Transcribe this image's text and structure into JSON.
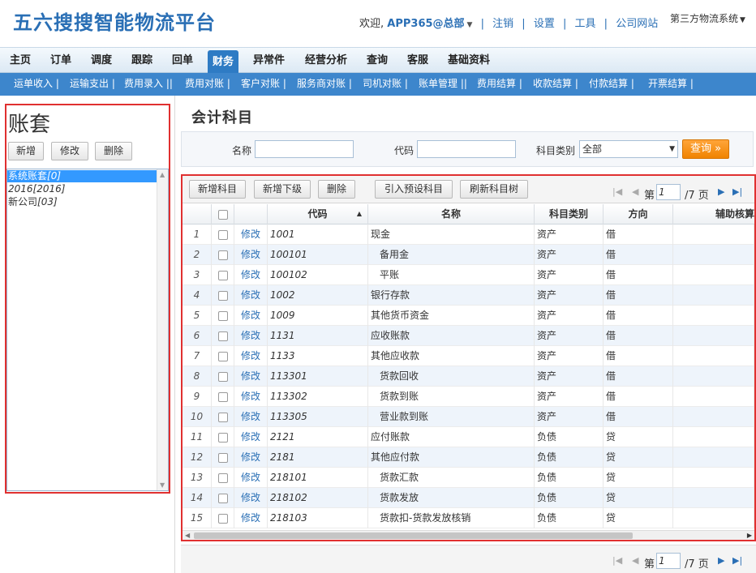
{
  "header": {
    "logo": "五六搜搜智能物流平台",
    "welcome": "欢迎,",
    "username": "APP365@总部",
    "links": [
      "注销",
      "设置",
      "工具",
      "公司网站"
    ],
    "system_switch": "第三方物流系统"
  },
  "main_nav": {
    "items": [
      "主页",
      "订单",
      "调度",
      "跟踪",
      "回单",
      "财务",
      "异常件",
      "经营分析",
      "查询",
      "客服",
      "基础资料"
    ],
    "active": "财务"
  },
  "sub_nav": {
    "items": [
      "运单收入 |",
      "运输支出 |",
      "费用录入 ||",
      "费用对账 |",
      "客户对账 |",
      "服务商对账 |",
      "司机对账 |",
      "账单管理 ||",
      "费用结算 |",
      "收款结算 |",
      "付款结算 |",
      "开票结算 |"
    ]
  },
  "left_panel": {
    "title": "账套",
    "buttons": {
      "add": "新增",
      "edit": "修改",
      "delete": "删除"
    },
    "accounts": [
      {
        "name": "系统账套",
        "code": "[0]",
        "selected": true
      },
      {
        "name": "2016",
        "code": "[2016]",
        "selected": false
      },
      {
        "name": "新公司",
        "code": "[03]",
        "selected": false
      }
    ]
  },
  "page_title": "会计科目",
  "search": {
    "name_label": "名称",
    "name_value": "",
    "code_label": "代码",
    "code_value": "",
    "category_label": "科目类别",
    "category_value": "全部",
    "query_button": "查询 »"
  },
  "toolbar": {
    "add_subject": "新增科目",
    "add_child": "新增下级",
    "delete": "删除",
    "import_preset": "引入预设科目",
    "refresh_tree": "刷新科目树"
  },
  "pager": {
    "prefix": "第",
    "current_page": "1",
    "suffix": "/7 页"
  },
  "grid": {
    "columns": {
      "code": "代码",
      "name": "名称",
      "category": "科目类别",
      "direction": "方向",
      "auxiliary": "辅助核算"
    },
    "edit_label": "修改",
    "rows": [
      {
        "num": "1",
        "code": "1001",
        "name": "现金",
        "category": "资产",
        "direction": "借",
        "indent": false
      },
      {
        "num": "2",
        "code": "100101",
        "name": "备用金",
        "category": "资产",
        "direction": "借",
        "indent": true
      },
      {
        "num": "3",
        "code": "100102",
        "name": "平账",
        "category": "资产",
        "direction": "借",
        "indent": true
      },
      {
        "num": "4",
        "code": "1002",
        "name": "银行存款",
        "category": "资产",
        "direction": "借",
        "indent": false
      },
      {
        "num": "5",
        "code": "1009",
        "name": "其他货币资金",
        "category": "资产",
        "direction": "借",
        "indent": false
      },
      {
        "num": "6",
        "code": "1131",
        "name": "应收账款",
        "category": "资产",
        "direction": "借",
        "indent": false
      },
      {
        "num": "7",
        "code": "1133",
        "name": "其他应收款",
        "category": "资产",
        "direction": "借",
        "indent": false
      },
      {
        "num": "8",
        "code": "113301",
        "name": "货款回收",
        "category": "资产",
        "direction": "借",
        "indent": true
      },
      {
        "num": "9",
        "code": "113302",
        "name": "货款到账",
        "category": "资产",
        "direction": "借",
        "indent": true
      },
      {
        "num": "10",
        "code": "113305",
        "name": "营业款到账",
        "category": "资产",
        "direction": "借",
        "indent": true
      },
      {
        "num": "11",
        "code": "2121",
        "name": "应付账款",
        "category": "负债",
        "direction": "贷",
        "indent": false
      },
      {
        "num": "12",
        "code": "2181",
        "name": "其他应付款",
        "category": "负债",
        "direction": "贷",
        "indent": false
      },
      {
        "num": "13",
        "code": "218101",
        "name": "货款汇款",
        "category": "负债",
        "direction": "贷",
        "indent": true
      },
      {
        "num": "14",
        "code": "218102",
        "name": "货款发放",
        "category": "负债",
        "direction": "贷",
        "indent": true
      },
      {
        "num": "15",
        "code": "218103",
        "name": "货款扣-货款发放核销",
        "category": "负债",
        "direction": "贷",
        "indent": true
      }
    ]
  },
  "colors": {
    "accent": "#2e7bc4",
    "subnav": "#3d86cc",
    "highlight_border": "#e03030",
    "query_button": "#f08300"
  }
}
